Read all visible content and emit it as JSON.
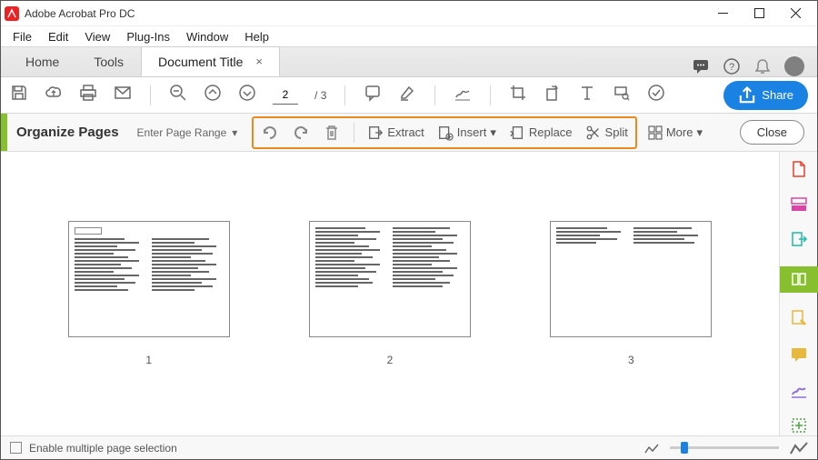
{
  "app": {
    "title": "Adobe Acrobat Pro DC"
  },
  "menu": [
    "File",
    "Edit",
    "View",
    "Plug-Ins",
    "Window",
    "Help"
  ],
  "tabs": {
    "home": "Home",
    "tools": "Tools",
    "doc": "Document Title"
  },
  "toolbar": {
    "page_current": "2",
    "page_sep": "/",
    "page_total": "3",
    "share": "Share"
  },
  "organize": {
    "title": "Organize Pages",
    "range": "Enter Page Range",
    "extract": "Extract",
    "insert": "Insert",
    "replace": "Replace",
    "split": "Split",
    "more": "More",
    "close": "Close"
  },
  "pages": [
    "1",
    "2",
    "3"
  ],
  "bottom": {
    "enable": "Enable multiple page selection"
  }
}
